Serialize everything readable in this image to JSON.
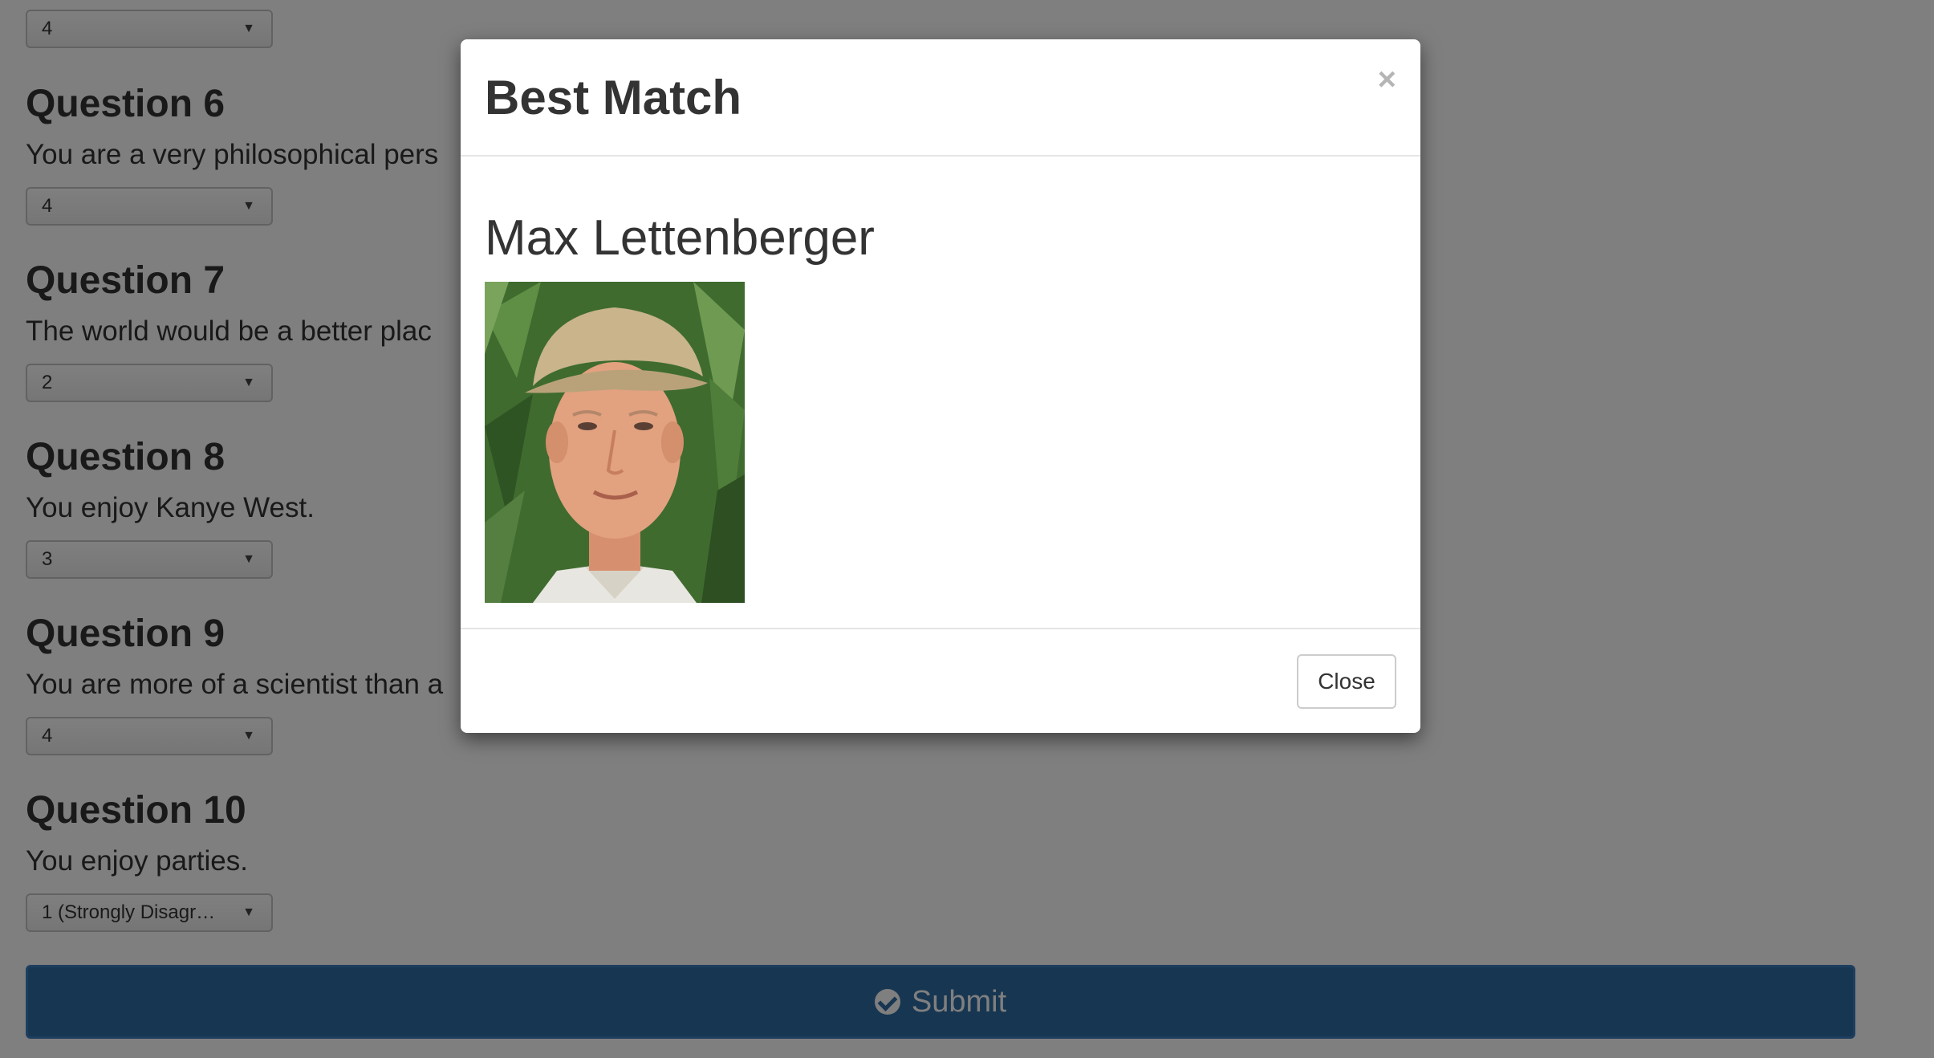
{
  "questions": [
    {
      "title": "",
      "text": "",
      "selected": "4"
    },
    {
      "title": "Question 6",
      "text": "You are a very philosophical pers",
      "selected": "4"
    },
    {
      "title": "Question 7",
      "text": "The world would be a better plac",
      "selected": "2"
    },
    {
      "title": "Question 8",
      "text": "You enjoy Kanye West.",
      "selected": "3"
    },
    {
      "title": "Question 9",
      "text": "You are more of a scientist than a",
      "selected": "4"
    },
    {
      "title": "Question 10",
      "text": "You enjoy parties.",
      "selected": "1 (Strongly Disagr…"
    }
  ],
  "submit": {
    "label": "Submit",
    "icon": "check-circle-icon",
    "color": "#2e6da4"
  },
  "modal": {
    "title": "Best Match",
    "close_symbol": "×",
    "match_name": "Max Lettenberger",
    "close_label": "Close"
  },
  "colors": {
    "backdrop": "rgba(0,0,0,0.5)",
    "text": "#333333"
  }
}
